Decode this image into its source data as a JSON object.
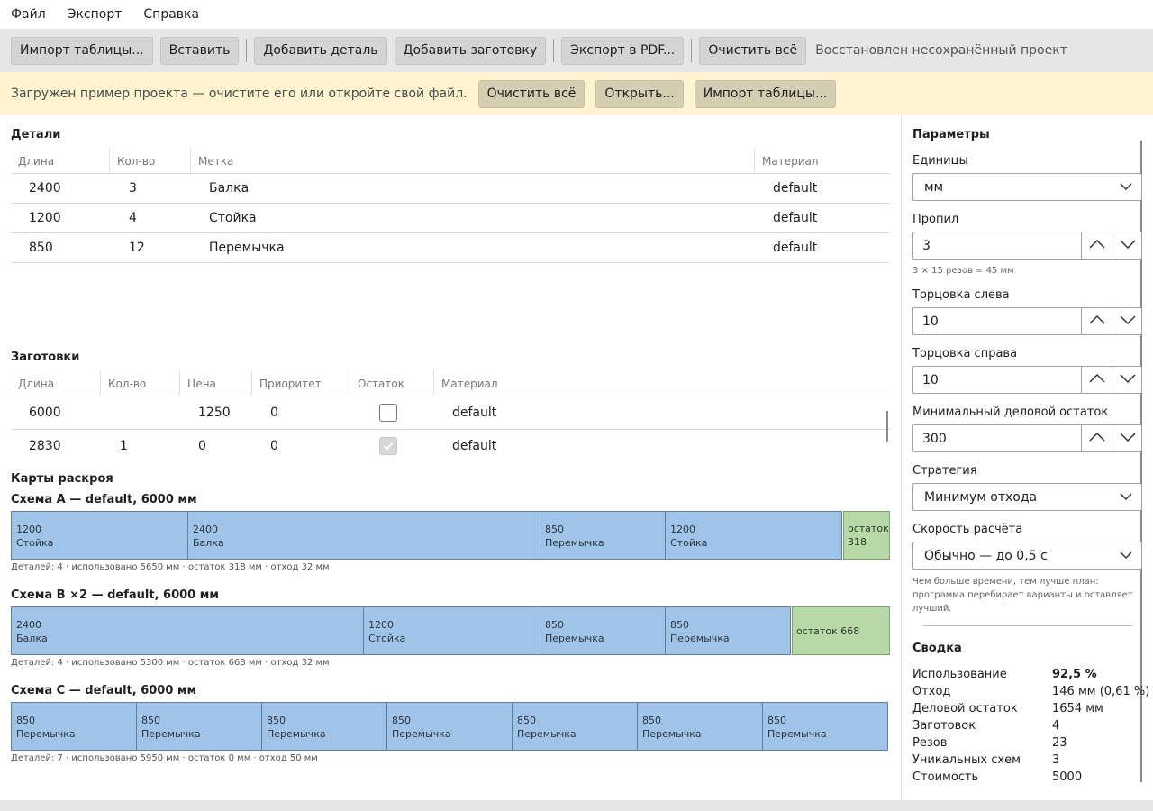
{
  "menu": {
    "file": "Файл",
    "export": "Экспорт",
    "help": "Справка"
  },
  "toolbar": {
    "import_table": "Импорт таблицы...",
    "paste": "Вставить",
    "add_part": "Добавить деталь",
    "add_stock": "Добавить заготовку",
    "export_pdf": "Экспорт в PDF...",
    "clear_all": "Очистить всё",
    "status": "Восстановлен несохранённый проект"
  },
  "banner": {
    "text": "Загружен пример проекта — очистите его или откройте свой файл.",
    "clear_all": "Очистить всё",
    "open": "Открыть...",
    "import_table": "Импорт таблицы..."
  },
  "parts": {
    "title": "Детали",
    "headers": {
      "length": "Длина",
      "qty": "Кол-во",
      "label": "Метка",
      "material": "Материал"
    },
    "rows": [
      {
        "length": "2400",
        "qty": "3",
        "label": "Балка",
        "material": "default"
      },
      {
        "length": "1200",
        "qty": "4",
        "label": "Стойка",
        "material": "default"
      },
      {
        "length": "850",
        "qty": "12",
        "label": "Перемычка",
        "material": "default"
      }
    ]
  },
  "stock": {
    "title": "Заготовки",
    "headers": {
      "length": "Длина",
      "qty": "Кол-во",
      "price": "Цена",
      "priority": "Приоритет",
      "remnant": "Остаток",
      "material": "Материал"
    },
    "rows": [
      {
        "length": "6000",
        "qty": "",
        "price": "1250",
        "priority": "0",
        "remnant": false,
        "material": "default"
      },
      {
        "length": "2830",
        "qty": "1",
        "price": "0",
        "priority": "0",
        "remnant": true,
        "material": "default"
      }
    ]
  },
  "cutting_maps": {
    "title": "Карты раскроя",
    "schemes": [
      {
        "title": "Схема A — default, 6000 мм",
        "pieces": [
          {
            "length": "1200",
            "label": "Стойка"
          },
          {
            "length": "2400",
            "label": "Балка"
          },
          {
            "length": "850",
            "label": "Перемычка"
          },
          {
            "length": "1200",
            "label": "Стойка"
          }
        ],
        "rest": {
          "line1": "остаток",
          "line2": "318"
        },
        "info": "Деталей: 4 · использовано 5650 мм · остаток 318 мм · отход 32 мм"
      },
      {
        "title": "Схема B ×2 — default, 6000 мм",
        "pieces": [
          {
            "length": "2400",
            "label": "Балка"
          },
          {
            "length": "1200",
            "label": "Стойка"
          },
          {
            "length": "850",
            "label": "Перемычка"
          },
          {
            "length": "850",
            "label": "Перемычка"
          }
        ],
        "rest": {
          "line1": "остаток 668",
          "line2": ""
        },
        "info": "Деталей: 4 · использовано 5300 мм · остаток 668 мм · отход 32 мм"
      },
      {
        "title": "Схема C — default, 6000 мм",
        "pieces": [
          {
            "length": "850",
            "label": "Перемычка"
          },
          {
            "length": "850",
            "label": "Перемычка"
          },
          {
            "length": "850",
            "label": "Перемычка"
          },
          {
            "length": "850",
            "label": "Перемычка"
          },
          {
            "length": "850",
            "label": "Перемычка"
          },
          {
            "length": "850",
            "label": "Перемычка"
          },
          {
            "length": "850",
            "label": "Перемычка"
          }
        ],
        "info": "Деталей: 7 · использовано 5950 мм · остаток 0 мм · отход 50 мм"
      }
    ]
  },
  "params": {
    "title": "Параметры",
    "units_label": "Единицы",
    "units_value": "мм",
    "kerf_label": "Пропил",
    "kerf_value": "3",
    "kerf_hint": "3 × 15 резов = 45 мм",
    "trim_left_label": "Торцовка слева",
    "trim_left_value": "10",
    "trim_right_label": "Торцовка справа",
    "trim_right_value": "10",
    "min_rest_label": "Минимальный деловой остаток",
    "min_rest_value": "300",
    "strategy_label": "Стратегия",
    "strategy_value": "Минимум отхода",
    "speed_label": "Скорость расчёта",
    "speed_value": "Обычно — до 0,5 с",
    "speed_hint": [
      "Чем больше времени, тем лучше план:",
      "программа перебирает варианты и оставляет",
      "лучший."
    ]
  },
  "summary": {
    "title": "Сводка",
    "rows": [
      {
        "label": "Использование",
        "value": "92,5 %",
        "bold": true
      },
      {
        "label": "Отход",
        "value": "146 мм (0,61 %)"
      },
      {
        "label": "Деловой остаток",
        "value": "1654 мм"
      },
      {
        "label": "Заготовок",
        "value": "4"
      },
      {
        "label": "Резов",
        "value": "23"
      },
      {
        "label": "Уникальных схем",
        "value": "3"
      },
      {
        "label": "Стоимость",
        "value": "5000"
      }
    ]
  }
}
